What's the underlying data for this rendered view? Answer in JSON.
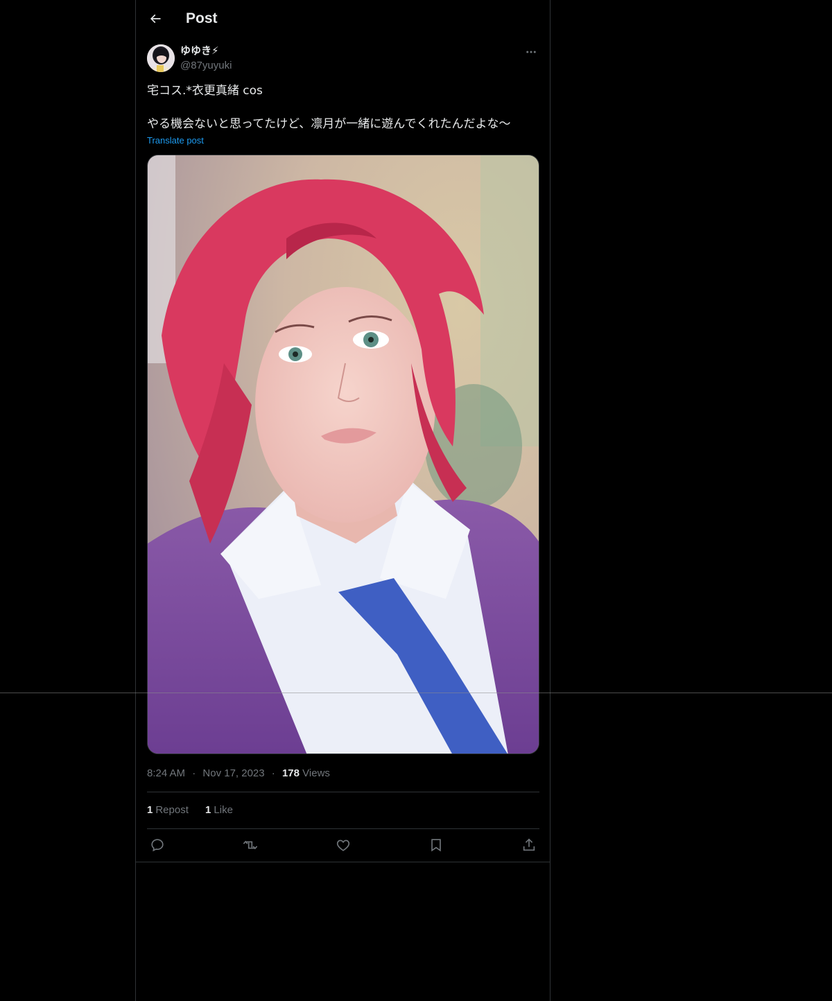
{
  "header": {
    "title": "Post",
    "back_icon": "arrow-left-icon"
  },
  "author": {
    "display_name": "ゆゆき⚡",
    "handle": "@87yuyuki",
    "avatar_icon": "avatar",
    "more_icon": "more-horizontal-icon"
  },
  "post": {
    "line1": "宅コス.*衣更真緒 cos",
    "line2": "やる機会ないと思ってたけど、凛月が一緒に遊んでくれたんだよな〜",
    "translate_label": "Translate post",
    "media_description_icon": "photo"
  },
  "meta": {
    "time": "8:24 AM",
    "separator": "·",
    "date": "Nov 17, 2023",
    "views_count": "178",
    "views_label": "Views"
  },
  "stats": {
    "reposts_count": "1",
    "reposts_label": "Repost",
    "likes_count": "1",
    "likes_label": "Like"
  },
  "actions": {
    "reply_icon": "reply-icon",
    "repost_icon": "repost-icon",
    "like_icon": "like-icon",
    "bookmark_icon": "bookmark-icon",
    "share_icon": "share-icon"
  },
  "colors": {
    "background": "#000000",
    "text_primary": "#e7e9ea",
    "text_secondary": "#71767b",
    "link": "#1d9bf0",
    "border": "#2f3336"
  }
}
